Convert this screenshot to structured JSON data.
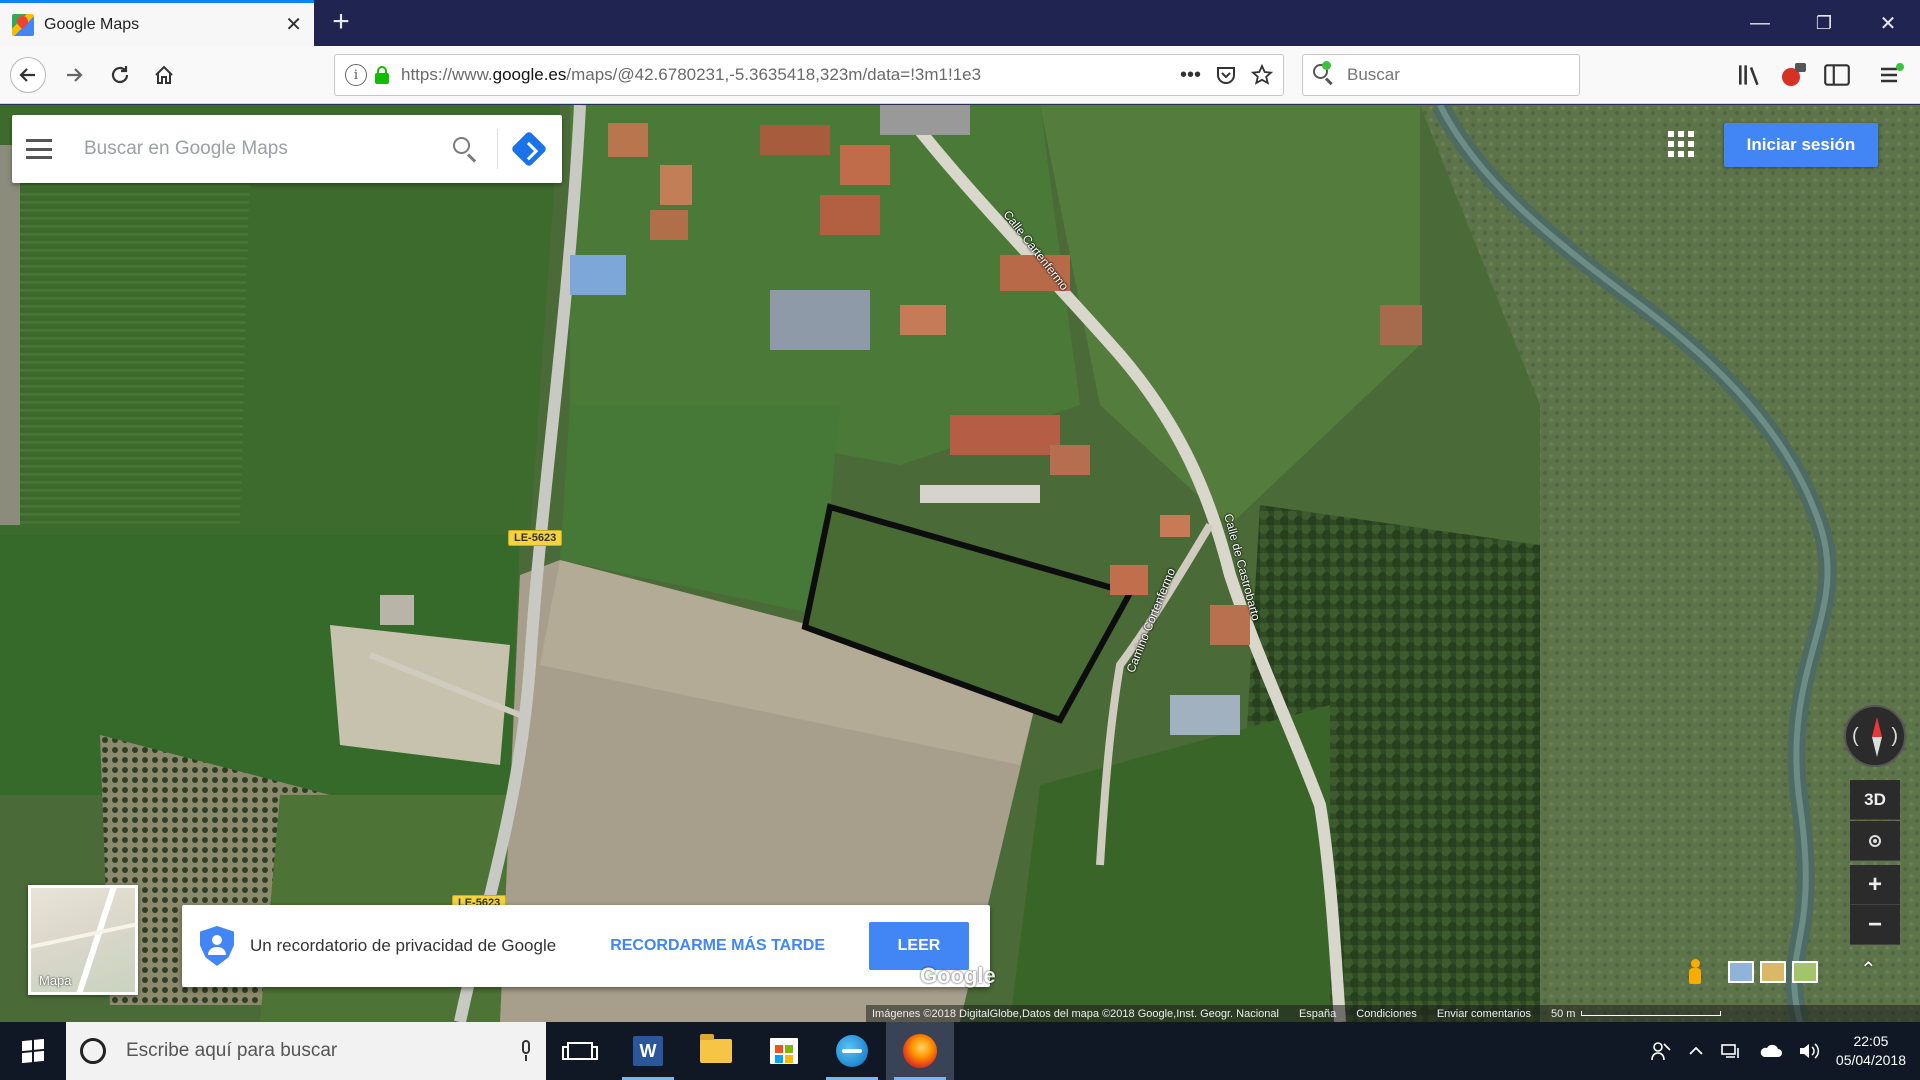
{
  "browser": {
    "tab_title": "Google Maps",
    "tab_close": "✕",
    "new_tab": "+",
    "window_controls": {
      "minimize": "—",
      "restore": "❐",
      "close": "✕"
    },
    "url_prefix": "https://www.",
    "url_domain": "google.es",
    "url_rest": "/maps/@42.6780231,-5.3635418,323m/data=!3m1!1e3",
    "url_actions": {
      "more": "•••"
    },
    "search_placeholder": "Buscar"
  },
  "maps": {
    "search_placeholder": "Buscar en Google Maps",
    "signin_label": "Iniciar sesión",
    "road_badge_1": "LE-5623",
    "road_badge_2": "LE-5623",
    "street_1": "Calle Cartenfermo",
    "street_2": "Calle de Castrobarto",
    "street_3": "Camino Cortenfermo",
    "minimap_label": "Mapa",
    "btn_3d": "3D",
    "zoom_in": "+",
    "zoom_out": "−",
    "expand": "⌃",
    "watermark": "Google",
    "attribution": {
      "imagery": "Imágenes ©2018 DigitalGlobe,Datos del mapa ©2018 Google,Inst. Geogr. Nacional",
      "country": "España",
      "terms": "Condiciones",
      "feedback": "Enviar comentarios",
      "scale": "50 m"
    }
  },
  "privacy": {
    "message": "Un recordatorio de privacidad de Google",
    "remind_later": "RECORDARME MÁS TARDE",
    "read": "LEER"
  },
  "taskbar": {
    "search_placeholder": "Escribe aquí para buscar",
    "word_letter": "W",
    "clock_time": "22:05",
    "clock_date": "05/04/2018"
  }
}
